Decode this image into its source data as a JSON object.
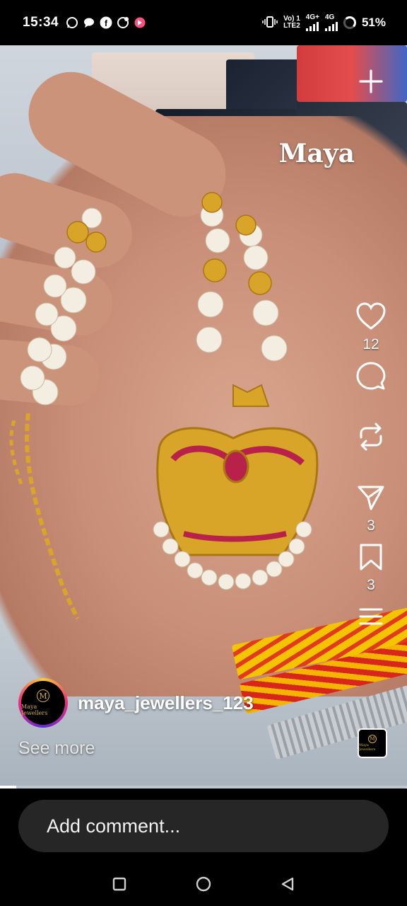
{
  "status_bar": {
    "time": "15:34",
    "network_top": "Vo) 1",
    "network_bottom": "LTE2",
    "sim1": "4G+",
    "sim2": "4G",
    "battery": "51%"
  },
  "video": {
    "watermark": "Maya",
    "progress_fraction": 0.04
  },
  "actions": {
    "likes": "12",
    "reposts": "",
    "shares": "3",
    "saves": "3"
  },
  "post": {
    "username": "maya_jewellers_123",
    "avatar_text": "Maya Jewellers",
    "avatar_monogram": "M",
    "see_more": "See more"
  },
  "comment": {
    "placeholder": "Add comment..."
  },
  "icons": {
    "create": "plus-icon",
    "like": "heart-icon",
    "comment": "comment-bubble-icon",
    "repost": "repost-icon",
    "share": "send-icon",
    "save": "bookmark-icon",
    "more": "more-icon",
    "nav_recents": "square-icon",
    "nav_home": "circle-icon",
    "nav_back": "triangle-back-icon"
  },
  "colors": {
    "background": "#000000",
    "comment_box": "#262626",
    "gold": "#d4af37"
  }
}
